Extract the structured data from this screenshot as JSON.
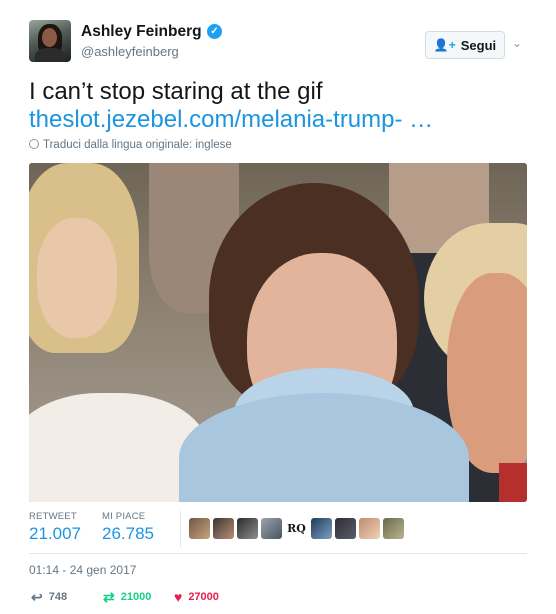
{
  "user": {
    "name": "Ashley Feinberg",
    "handle": "@ashleyfeinberg",
    "verified": true
  },
  "follow_button": {
    "label": "Segui",
    "icon": "add-user-icon"
  },
  "tweet": {
    "text": "I can’t stop staring at the gif",
    "link": "theslot.jezebel.com/melania-trump-  …"
  },
  "translate": {
    "label": "Traduci dalla lingua originale: inglese",
    "icon": "globe-icon"
  },
  "media": {
    "type": "gif",
    "description_icon": "gif-image"
  },
  "stats": {
    "retweet_label": "RETWEET",
    "retweet_value": "21.007",
    "likes_label": "MI PIACE",
    "likes_value": "26.785",
    "liker_avatars": [
      "avatar-1",
      "avatar-2",
      "avatar-3",
      "avatar-4",
      "RQ",
      "avatar-6",
      "avatar-7",
      "avatar-8",
      "avatar-9"
    ]
  },
  "timestamp": "01:14 - 24 gen 2017",
  "actions": {
    "reply_count": "748",
    "retweet_count": "21000",
    "like_count": "27000"
  },
  "colors": {
    "link": "#1b95e0",
    "retweet": "#19cf86",
    "like": "#e81c4f",
    "verified": "#1da1f2"
  }
}
